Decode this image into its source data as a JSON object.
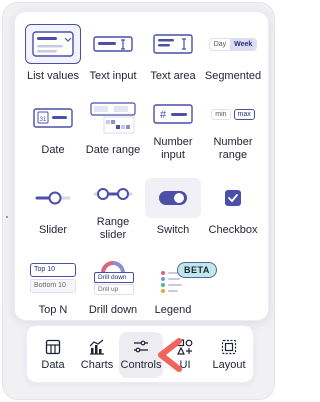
{
  "controls": [
    {
      "label": "List values",
      "icon": "list-values-icon",
      "selected": true
    },
    {
      "label": "Text input",
      "icon": "text-input-icon"
    },
    {
      "label": "Text area",
      "icon": "text-area-icon"
    },
    {
      "label": "Segmented",
      "icon": "segmented-icon",
      "seg_a": "Day",
      "seg_b": "Week"
    },
    {
      "label": "Date",
      "icon": "date-icon",
      "date_num": "31"
    },
    {
      "label": "Date range",
      "icon": "date-range-icon"
    },
    {
      "label": "Number\ninput",
      "icon": "number-input-icon"
    },
    {
      "label": "Number\nrange",
      "icon": "number-range-icon",
      "min": "min",
      "max": "max"
    },
    {
      "label": "Slider",
      "icon": "slider-icon"
    },
    {
      "label": "Range\nslider",
      "icon": "range-slider-icon"
    },
    {
      "label": "Switch",
      "icon": "switch-icon"
    },
    {
      "label": "Checkbox",
      "icon": "checkbox-icon"
    },
    {
      "label": "Top N",
      "icon": "top-n-icon",
      "opt1": "Top 10",
      "opt2": "Bottom 10"
    },
    {
      "label": "Drill down",
      "icon": "drill-down-icon",
      "opt1": "Drill down",
      "opt2": "Drill up"
    },
    {
      "label": "Legend",
      "icon": "legend-icon",
      "badge": "BETA"
    }
  ],
  "tabs": [
    {
      "label": "Data",
      "icon": "table-icon"
    },
    {
      "label": "Charts",
      "icon": "charts-icon"
    },
    {
      "label": "Controls",
      "icon": "sliders-icon",
      "active": true
    },
    {
      "label": "UI",
      "icon": "shapes-icon"
    },
    {
      "label": "Layout",
      "icon": "layout-icon"
    }
  ],
  "colors": {
    "accent": "#4b4fa8",
    "pointer": "#f0645a",
    "teal": "#bfe9e9"
  }
}
